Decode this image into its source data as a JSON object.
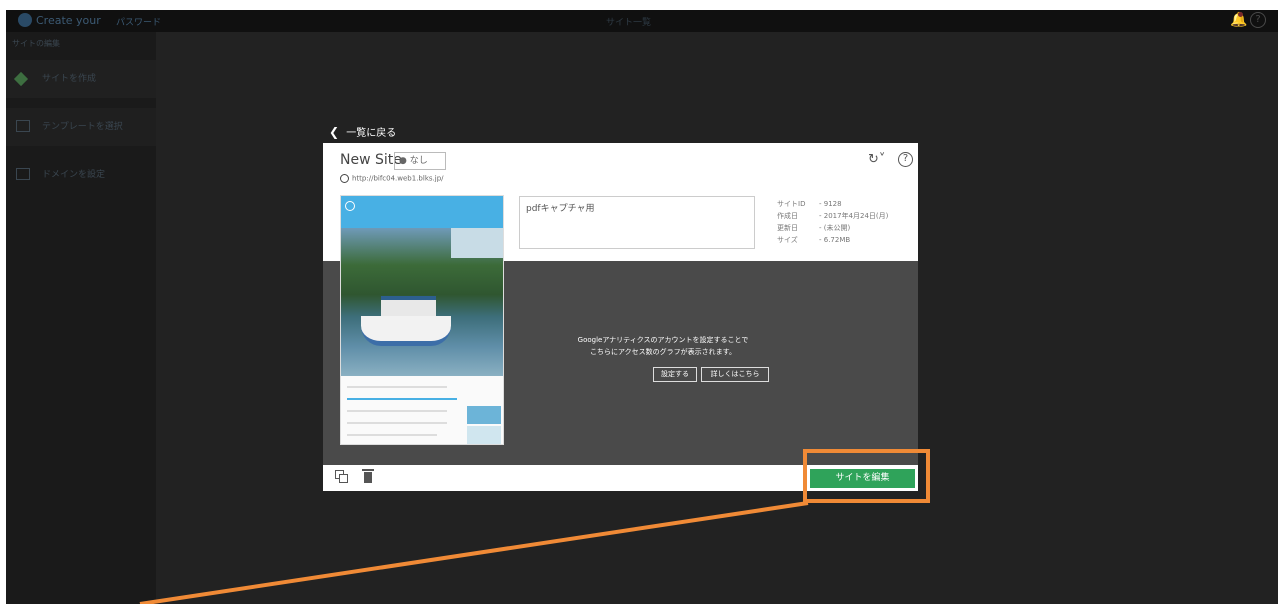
{
  "topbar": {
    "brand": "Create your",
    "account_label": "パスワード",
    "center_label": "サイト一覧"
  },
  "sidebar": {
    "title": "サイトの編集",
    "items": [
      {
        "label": "サイトを作成"
      },
      {
        "label": "テンプレートを選択"
      },
      {
        "label": "ドメインを設定"
      }
    ]
  },
  "back_link": {
    "label": "一覧に戻る"
  },
  "site": {
    "name": "New Site",
    "status": "● なし",
    "url": "http://bifc04.web1.blks.jp/",
    "memo": "pdfキャプチャ用",
    "info": [
      {
        "label": "サイトID",
        "value": "- 9128"
      },
      {
        "label": "作成日",
        "value": "- 2017年4月24日(月)"
      },
      {
        "label": "更新日",
        "value": "- (未公開)"
      },
      {
        "label": "サイズ",
        "value": "- 6.72MB"
      }
    ]
  },
  "analytics": {
    "message_line1": "Googleアナリティクスのアカウントを設定することで",
    "message_line2": "こちらにアクセス数のグラフが表示されます。",
    "setup_label": "設定する",
    "more_label": "詳しくはこちら"
  },
  "footer": {
    "edit_label": "サイトを編集"
  },
  "colors": {
    "edit_button": "#2fa35a",
    "highlight": "#f08a36",
    "preview_header": "#48b0e4"
  }
}
